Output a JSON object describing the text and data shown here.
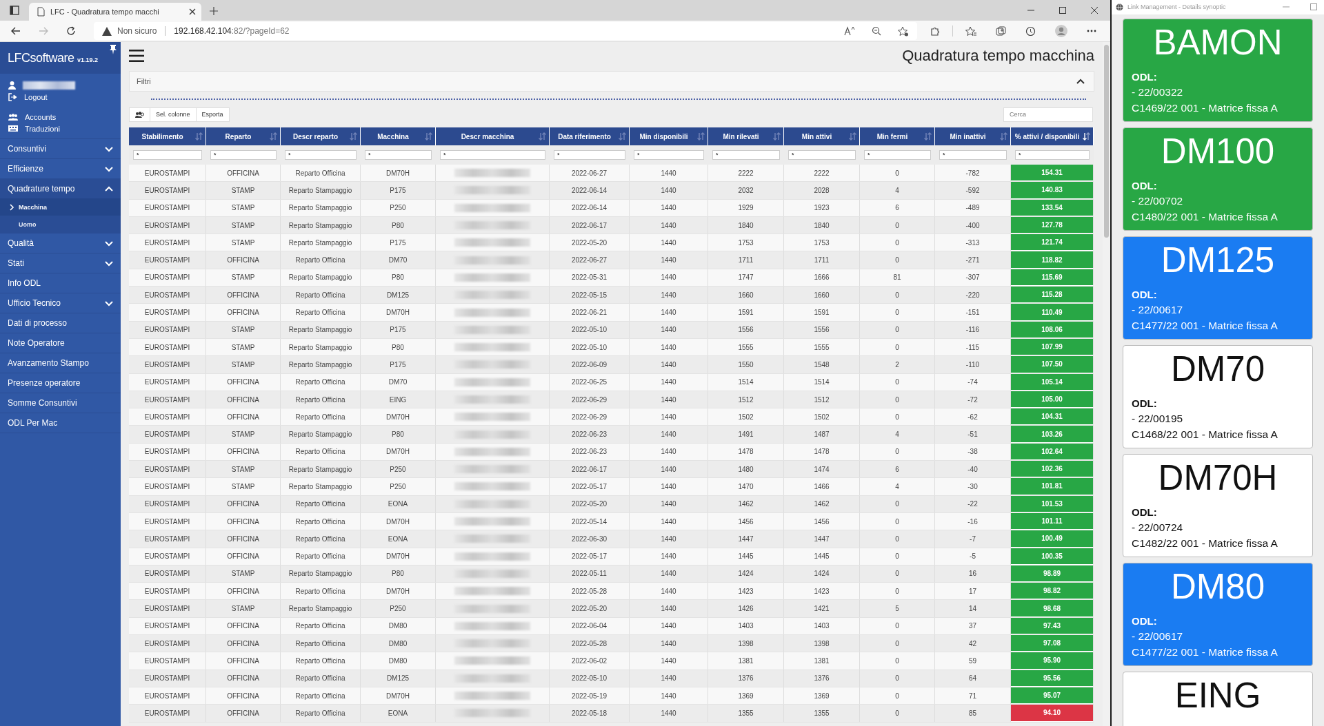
{
  "browser": {
    "tab_title": "LFC - Quadratura tempo macchi",
    "security": "Non sicuro",
    "url_host": "192.168.42.104",
    "url_rest": ":82/?pageId=62"
  },
  "sidebar": {
    "brand": "LFCsoftware",
    "version": "v1.19.2",
    "user": {
      "redacted": true
    },
    "user_links": [
      {
        "label": "Logout"
      }
    ],
    "admin_links": [
      {
        "label": "Accounts",
        "kind": "group"
      },
      {
        "label": "Traduzioni",
        "kind": "keyboard"
      }
    ],
    "menu": [
      {
        "label": "Consuntivi",
        "expandable": true,
        "expanded": false
      },
      {
        "label": "Efficienze",
        "expandable": true,
        "expanded": false
      },
      {
        "label": "Quadrature tempo",
        "expandable": true,
        "expanded": true,
        "children": [
          {
            "label": "Macchina",
            "selected": true
          },
          {
            "label": "Uomo",
            "selected": false
          }
        ]
      },
      {
        "label": "Qualità",
        "expandable": true,
        "expanded": false
      },
      {
        "label": "Stati",
        "expandable": true,
        "expanded": false
      },
      {
        "label": "Info ODL",
        "expandable": false,
        "expanded": false
      },
      {
        "label": "Ufficio Tecnico",
        "expandable": true,
        "expanded": false
      },
      {
        "label": "Dati di processo",
        "expandable": false,
        "expanded": false
      },
      {
        "label": "Note Operatore",
        "expandable": false,
        "expanded": false
      },
      {
        "label": "Avanzamento Stampo",
        "expandable": false,
        "expanded": false
      },
      {
        "label": "Presenze operatore",
        "expandable": false,
        "expanded": false
      },
      {
        "label": "Somme Consuntivi",
        "expandable": false,
        "expanded": false
      },
      {
        "label": "ODL Per Mac",
        "expandable": false,
        "expanded": false
      }
    ]
  },
  "page": {
    "title": "Quadratura tempo macchina",
    "filter_panel": {
      "label": "Filtri",
      "expanded": true
    },
    "toolbar": [
      "Sel. colonne",
      "Esporta"
    ],
    "search": {
      "placeholder": "Cerca"
    }
  },
  "table": {
    "columns": [
      {
        "label": "Stabilimento",
        "sorted": false,
        "filter": "*",
        "redacted": false
      },
      {
        "label": "Reparto",
        "sorted": false,
        "filter": "*",
        "redacted": false
      },
      {
        "label": "Descr reparto",
        "sorted": false,
        "filter": "*",
        "redacted": false
      },
      {
        "label": "Macchina",
        "sorted": false,
        "filter": "*",
        "redacted": false
      },
      {
        "label": "Descr macchina",
        "sorted": false,
        "filter": "*",
        "redacted": true
      },
      {
        "label": "Data riferimento",
        "sorted": false,
        "filter": "*",
        "redacted": false
      },
      {
        "label": "Min disponibili",
        "sorted": false,
        "filter": "*",
        "redacted": false
      },
      {
        "label": "Min rilevati",
        "sorted": false,
        "filter": "*",
        "redacted": false
      },
      {
        "label": "Min attivi",
        "sorted": false,
        "filter": "*",
        "redacted": false
      },
      {
        "label": "Min fermi",
        "sorted": false,
        "filter": "*",
        "redacted": false
      },
      {
        "label": "Min inattivi",
        "sorted": false,
        "filter": "*",
        "redacted": false
      },
      {
        "label": "% attivi / disponibili",
        "sorted": true,
        "filter": "*",
        "redacted": false
      }
    ],
    "rows": [
      {
        "color": "#28a745",
        "cells": [
          "EUROSTAMPI",
          "OFFICINA",
          "Reparto Officina",
          "DM70H",
          "",
          "2022-06-27",
          "1440",
          "2222",
          "2222",
          "0",
          "-782",
          "154.31"
        ]
      },
      {
        "color": "#28a745",
        "cells": [
          "EUROSTAMPI",
          "STAMP",
          "Reparto Stampaggio",
          "P175",
          "",
          "2022-06-14",
          "1440",
          "2032",
          "2028",
          "4",
          "-592",
          "140.83"
        ]
      },
      {
        "color": "#28a745",
        "cells": [
          "EUROSTAMPI",
          "STAMP",
          "Reparto Stampaggio",
          "P250",
          "",
          "2022-06-14",
          "1440",
          "1929",
          "1923",
          "6",
          "-489",
          "133.54"
        ]
      },
      {
        "color": "#28a745",
        "cells": [
          "EUROSTAMPI",
          "STAMP",
          "Reparto Stampaggio",
          "P80",
          "",
          "2022-06-17",
          "1440",
          "1840",
          "1840",
          "0",
          "-400",
          "127.78"
        ]
      },
      {
        "color": "#28a745",
        "cells": [
          "EUROSTAMPI",
          "STAMP",
          "Reparto Stampaggio",
          "P175",
          "",
          "2022-05-20",
          "1440",
          "1753",
          "1753",
          "0",
          "-313",
          "121.74"
        ]
      },
      {
        "color": "#28a745",
        "cells": [
          "EUROSTAMPI",
          "OFFICINA",
          "Reparto Officina",
          "DM70",
          "",
          "2022-06-27",
          "1440",
          "1711",
          "1711",
          "0",
          "-271",
          "118.82"
        ]
      },
      {
        "color": "#28a745",
        "cells": [
          "EUROSTAMPI",
          "STAMP",
          "Reparto Stampaggio",
          "P80",
          "",
          "2022-05-31",
          "1440",
          "1747",
          "1666",
          "81",
          "-307",
          "115.69"
        ]
      },
      {
        "color": "#28a745",
        "cells": [
          "EUROSTAMPI",
          "OFFICINA",
          "Reparto Officina",
          "DM125",
          "",
          "2022-05-15",
          "1440",
          "1660",
          "1660",
          "0",
          "-220",
          "115.28"
        ]
      },
      {
        "color": "#28a745",
        "cells": [
          "EUROSTAMPI",
          "OFFICINA",
          "Reparto Officina",
          "DM70H",
          "",
          "2022-06-21",
          "1440",
          "1591",
          "1591",
          "0",
          "-151",
          "110.49"
        ]
      },
      {
        "color": "#28a745",
        "cells": [
          "EUROSTAMPI",
          "STAMP",
          "Reparto Stampaggio",
          "P175",
          "",
          "2022-05-10",
          "1440",
          "1556",
          "1556",
          "0",
          "-116",
          "108.06"
        ]
      },
      {
        "color": "#28a745",
        "cells": [
          "EUROSTAMPI",
          "STAMP",
          "Reparto Stampaggio",
          "P80",
          "",
          "2022-05-10",
          "1440",
          "1555",
          "1555",
          "0",
          "-115",
          "107.99"
        ]
      },
      {
        "color": "#28a745",
        "cells": [
          "EUROSTAMPI",
          "STAMP",
          "Reparto Stampaggio",
          "P175",
          "",
          "2022-06-09",
          "1440",
          "1550",
          "1548",
          "2",
          "-110",
          "107.50"
        ]
      },
      {
        "color": "#28a745",
        "cells": [
          "EUROSTAMPI",
          "OFFICINA",
          "Reparto Officina",
          "DM70",
          "",
          "2022-06-25",
          "1440",
          "1514",
          "1514",
          "0",
          "-74",
          "105.14"
        ]
      },
      {
        "color": "#28a745",
        "cells": [
          "EUROSTAMPI",
          "OFFICINA",
          "Reparto Officina",
          "EING",
          "",
          "2022-06-29",
          "1440",
          "1512",
          "1512",
          "0",
          "-72",
          "105.00"
        ]
      },
      {
        "color": "#28a745",
        "cells": [
          "EUROSTAMPI",
          "OFFICINA",
          "Reparto Officina",
          "DM70H",
          "",
          "2022-06-29",
          "1440",
          "1502",
          "1502",
          "0",
          "-62",
          "104.31"
        ]
      },
      {
        "color": "#28a745",
        "cells": [
          "EUROSTAMPI",
          "STAMP",
          "Reparto Stampaggio",
          "P80",
          "",
          "2022-06-23",
          "1440",
          "1491",
          "1487",
          "4",
          "-51",
          "103.26"
        ]
      },
      {
        "color": "#28a745",
        "cells": [
          "EUROSTAMPI",
          "OFFICINA",
          "Reparto Officina",
          "DM70H",
          "",
          "2022-06-23",
          "1440",
          "1478",
          "1478",
          "0",
          "-38",
          "102.64"
        ]
      },
      {
        "color": "#28a745",
        "cells": [
          "EUROSTAMPI",
          "STAMP",
          "Reparto Stampaggio",
          "P250",
          "",
          "2022-06-17",
          "1440",
          "1480",
          "1474",
          "6",
          "-40",
          "102.36"
        ]
      },
      {
        "color": "#28a745",
        "cells": [
          "EUROSTAMPI",
          "STAMP",
          "Reparto Stampaggio",
          "P250",
          "",
          "2022-05-17",
          "1440",
          "1470",
          "1466",
          "4",
          "-30",
          "101.81"
        ]
      },
      {
        "color": "#28a745",
        "cells": [
          "EUROSTAMPI",
          "OFFICINA",
          "Reparto Officina",
          "EONA",
          "",
          "2022-05-20",
          "1440",
          "1462",
          "1462",
          "0",
          "-22",
          "101.53"
        ]
      },
      {
        "color": "#28a745",
        "cells": [
          "EUROSTAMPI",
          "OFFICINA",
          "Reparto Officina",
          "DM70H",
          "",
          "2022-05-14",
          "1440",
          "1456",
          "1456",
          "0",
          "-16",
          "101.11"
        ]
      },
      {
        "color": "#28a745",
        "cells": [
          "EUROSTAMPI",
          "OFFICINA",
          "Reparto Officina",
          "EONA",
          "",
          "2022-06-30",
          "1440",
          "1447",
          "1447",
          "0",
          "-7",
          "100.49"
        ]
      },
      {
        "color": "#28a745",
        "cells": [
          "EUROSTAMPI",
          "OFFICINA",
          "Reparto Officina",
          "DM70H",
          "",
          "2022-05-17",
          "1440",
          "1445",
          "1445",
          "0",
          "-5",
          "100.35"
        ]
      },
      {
        "color": "#28a745",
        "cells": [
          "EUROSTAMPI",
          "STAMP",
          "Reparto Stampaggio",
          "P80",
          "",
          "2022-05-11",
          "1440",
          "1424",
          "1424",
          "0",
          "16",
          "98.89"
        ]
      },
      {
        "color": "#28a745",
        "cells": [
          "EUROSTAMPI",
          "OFFICINA",
          "Reparto Officina",
          "DM70H",
          "",
          "2022-05-28",
          "1440",
          "1423",
          "1423",
          "0",
          "17",
          "98.82"
        ]
      },
      {
        "color": "#28a745",
        "cells": [
          "EUROSTAMPI",
          "STAMP",
          "Reparto Stampaggio",
          "P250",
          "",
          "2022-05-20",
          "1440",
          "1426",
          "1421",
          "5",
          "14",
          "98.68"
        ]
      },
      {
        "color": "#28a745",
        "cells": [
          "EUROSTAMPI",
          "OFFICINA",
          "Reparto Officina",
          "DM80",
          "",
          "2022-06-04",
          "1440",
          "1403",
          "1403",
          "0",
          "37",
          "97.43"
        ]
      },
      {
        "color": "#28a745",
        "cells": [
          "EUROSTAMPI",
          "OFFICINA",
          "Reparto Officina",
          "DM80",
          "",
          "2022-05-28",
          "1440",
          "1398",
          "1398",
          "0",
          "42",
          "97.08"
        ]
      },
      {
        "color": "#28a745",
        "cells": [
          "EUROSTAMPI",
          "OFFICINA",
          "Reparto Officina",
          "DM80",
          "",
          "2022-06-02",
          "1440",
          "1381",
          "1381",
          "0",
          "59",
          "95.90"
        ]
      },
      {
        "color": "#28a745",
        "cells": [
          "EUROSTAMPI",
          "OFFICINA",
          "Reparto Officina",
          "DM125",
          "",
          "2022-05-10",
          "1440",
          "1376",
          "1376",
          "0",
          "64",
          "95.56"
        ]
      },
      {
        "color": "#28a745",
        "cells": [
          "EUROSTAMPI",
          "OFFICINA",
          "Reparto Officina",
          "DM70H",
          "",
          "2022-05-19",
          "1440",
          "1369",
          "1369",
          "0",
          "71",
          "95.07"
        ]
      },
      {
        "color": "#dc3545",
        "cells": [
          "EUROSTAMPI",
          "OFFICINA",
          "Reparto Officina",
          "EONA",
          "",
          "2022-05-18",
          "1440",
          "1355",
          "1355",
          "0",
          "85",
          "94.10"
        ]
      }
    ]
  },
  "synoptic": {
    "window_title": "Link Management - Details synoptic",
    "cards": [
      {
        "machine": "BAMON",
        "color": "#28a745",
        "odl_label": "ODL:",
        "odl": "- 22/00322",
        "detail": "C1469/22 001 - Matrice fissa A"
      },
      {
        "machine": "DM100",
        "color": "#28a745",
        "odl_label": "ODL:",
        "odl": "- 22/00702",
        "detail": "C1480/22 001 - Matrice fissa A"
      },
      {
        "machine": "DM125",
        "color": "#1a7cf2",
        "odl_label": "ODL:",
        "odl": "- 22/00617",
        "detail": "C1477/22 001 - Matrice fissa A"
      },
      {
        "machine": "DM70",
        "color": "#ffffff",
        "odl_label": "ODL:",
        "odl": "- 22/00195",
        "detail": "C1468/22 001 - Matrice fissa A"
      },
      {
        "machine": "DM70H",
        "color": "#ffffff",
        "odl_label": "ODL:",
        "odl": "- 22/00724",
        "detail": "C1482/22 001 - Matrice fissa A"
      },
      {
        "machine": "DM80",
        "color": "#1a7cf2",
        "odl_label": "ODL:",
        "odl": "- 22/00617",
        "detail": "C1477/22 001 - Matrice fissa A"
      },
      {
        "machine": "EING",
        "color": "#ffffff"
      }
    ]
  }
}
